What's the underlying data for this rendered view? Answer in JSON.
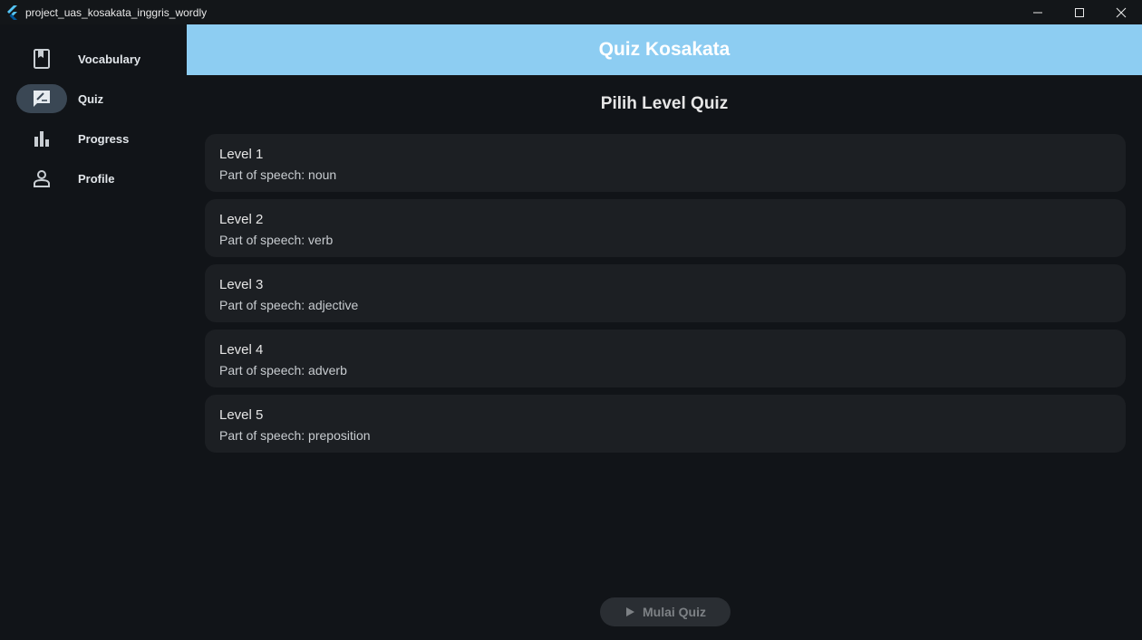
{
  "window": {
    "title": "project_uas_kosakata_inggris_wordly"
  },
  "sidebar": {
    "items": [
      {
        "label": "Vocabulary",
        "icon": "bookmark-book-icon",
        "active": false
      },
      {
        "label": "Quiz",
        "icon": "quiz-edit-icon",
        "active": true
      },
      {
        "label": "Progress",
        "icon": "bar-chart-icon",
        "active": false
      },
      {
        "label": "Profile",
        "icon": "person-icon",
        "active": false
      }
    ]
  },
  "appbar": {
    "title": "Quiz Kosakata",
    "color": "#8dcdf2"
  },
  "main": {
    "section_title": "Pilih Level Quiz",
    "levels": [
      {
        "name": "Level 1",
        "description": "Part of speech: noun"
      },
      {
        "name": "Level 2",
        "description": "Part of speech: verb"
      },
      {
        "name": "Level 3",
        "description": "Part of speech: adjective"
      },
      {
        "name": "Level 4",
        "description": "Part of speech: adverb"
      },
      {
        "name": "Level 5",
        "description": "Part of speech: preposition"
      }
    ],
    "start_button": {
      "label": "Mulai Quiz",
      "icon": "play-icon",
      "enabled": false
    }
  }
}
